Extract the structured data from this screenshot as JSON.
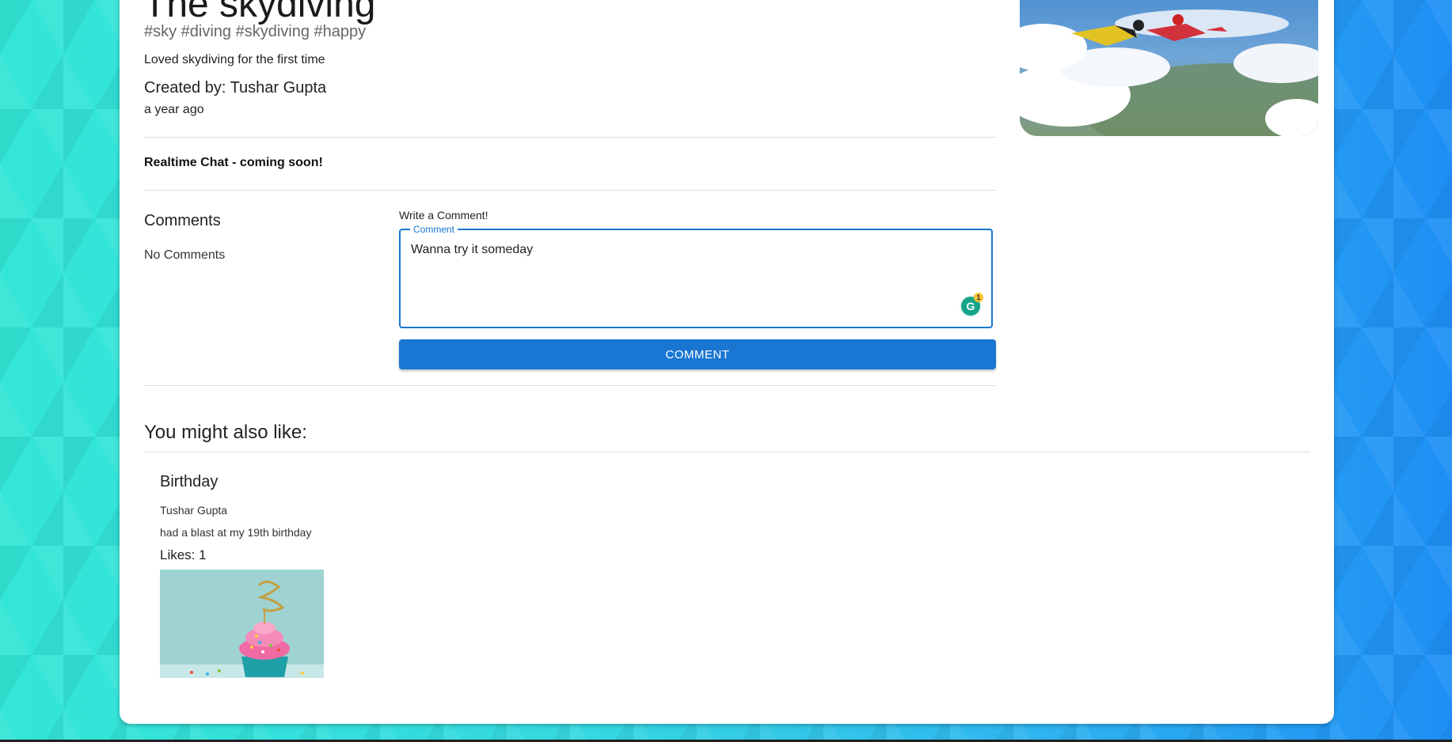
{
  "post": {
    "title": "The skydiving",
    "tags": "#sky #diving #skydiving #happy",
    "description": "Loved skydiving for the first time",
    "created_by": "Created by: Tushar Gupta",
    "time_ago": "a year ago",
    "image_icon": "skydivers-photo"
  },
  "chat": {
    "label": "Realtime Chat - coming soon!"
  },
  "comments": {
    "heading": "Comments",
    "empty_text": "No Comments",
    "write_label": "Write a Comment!",
    "field_legend": "Comment",
    "field_value": "Wanna try it someday",
    "grammarly_count": "1",
    "submit_label": "COMMENT"
  },
  "recommendations": {
    "heading": "You might also like:",
    "items": [
      {
        "title": "Birthday",
        "author": "Tushar Gupta",
        "description": "had a blast at my 19th birthday",
        "likes": "Likes: 1",
        "image_icon": "birthday-cupcake-photo"
      }
    ]
  },
  "colors": {
    "accent": "#1976d2",
    "grammarly": "#15a38a"
  }
}
